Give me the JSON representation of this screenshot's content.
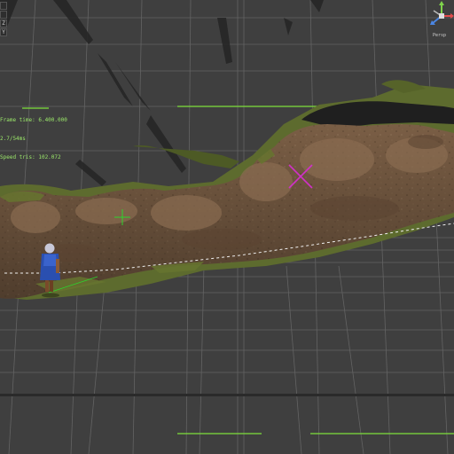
{
  "viewport": {
    "name": "3D scene viewport",
    "background_color": "#3f3f3f",
    "grid_color": "#6a6a6a",
    "highlight_line_color": "#7de03a"
  },
  "toolbar": {
    "buttons": [
      {
        "label": "",
        "icon": "select-icon"
      },
      {
        "label": "",
        "icon": "move-icon"
      },
      {
        "label": "Z",
        "icon": "z-axis-icon"
      },
      {
        "label": "Y",
        "icon": "y-axis-icon"
      }
    ]
  },
  "stats_overlay": {
    "lines": [
      "Frame time: 6.400.000",
      "2.7/54ms",
      "Speed tris: 102.072"
    ],
    "color": "#9be86a"
  },
  "orientation_gizmo": {
    "label": "Persp",
    "axis_x_color": "#e34b4b",
    "axis_y_color": "#7fd34b",
    "axis_z_color": "#4b86e3"
  },
  "scene": {
    "terrain_color": "#7a5e45",
    "moss_color": "#5d6b2e",
    "character": "hooded-adventurer",
    "markers": [
      {
        "name": "target-marker",
        "color": "#d030c8"
      },
      {
        "name": "pivot-marker",
        "color": "#2dd42d"
      }
    ]
  }
}
